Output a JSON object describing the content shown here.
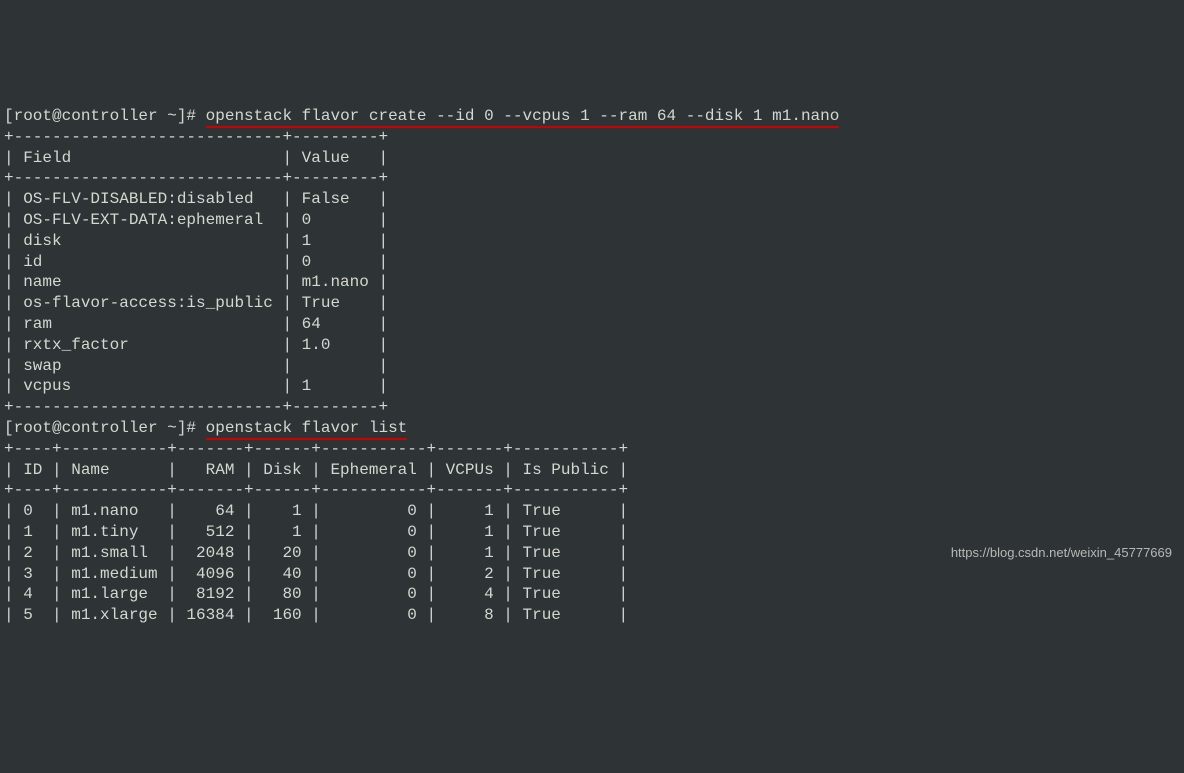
{
  "prompt1_prefix": "[root@controller ~]# ",
  "command1": "openstack flavor create --id 0 --vcpus 1 --ram 64 --disk 1 m1.nano",
  "divider1": "+----------------------------+---------+",
  "header1": "| Field                      | Value   |",
  "rows1": [
    "| OS-FLV-DISABLED:disabled   | False   |",
    "| OS-FLV-EXT-DATA:ephemeral  | 0       |",
    "| disk                       | 1       |",
    "| id                         | 0       |",
    "| name                       | m1.nano |",
    "| os-flavor-access:is_public | True    |",
    "| ram                        | 64      |",
    "| rxtx_factor                | 1.0     |",
    "| swap                       |         |",
    "| vcpus                      | 1       |"
  ],
  "prompt2_prefix": "[root@controller ~]# ",
  "command2": "openstack flavor list",
  "divider2": "+----+-----------+-------+------+-----------+-------+-----------+",
  "header2": "| ID | Name      |   RAM | Disk | Ephemeral | VCPUs | Is Public |",
  "rows2": [
    "| 0  | m1.nano   |    64 |    1 |         0 |     1 | True      |",
    "| 1  | m1.tiny   |   512 |    1 |         0 |     1 | True      |",
    "| 2  | m1.small  |  2048 |   20 |         0 |     1 | True      |",
    "| 3  | m1.medium |  4096 |   40 |         0 |     2 | True      |",
    "| 4  | m1.large  |  8192 |   80 |         0 |     4 | True      |",
    "| 5  | m1.xlarge | 16384 |  160 |         0 |     8 | True      |"
  ],
  "create_table": {
    "fields": [
      {
        "field": "OS-FLV-DISABLED:disabled",
        "value": "False"
      },
      {
        "field": "OS-FLV-EXT-DATA:ephemeral",
        "value": "0"
      },
      {
        "field": "disk",
        "value": "1"
      },
      {
        "field": "id",
        "value": "0"
      },
      {
        "field": "name",
        "value": "m1.nano"
      },
      {
        "field": "os-flavor-access:is_public",
        "value": "True"
      },
      {
        "field": "ram",
        "value": "64"
      },
      {
        "field": "rxtx_factor",
        "value": "1.0"
      },
      {
        "field": "swap",
        "value": ""
      },
      {
        "field": "vcpus",
        "value": "1"
      }
    ]
  },
  "list_table": {
    "headers": [
      "ID",
      "Name",
      "RAM",
      "Disk",
      "Ephemeral",
      "VCPUs",
      "Is Public"
    ],
    "data": [
      {
        "ID": "0",
        "Name": "m1.nano",
        "RAM": 64,
        "Disk": 1,
        "Ephemeral": 0,
        "VCPUs": 1,
        "Is Public": "True"
      },
      {
        "ID": "1",
        "Name": "m1.tiny",
        "RAM": 512,
        "Disk": 1,
        "Ephemeral": 0,
        "VCPUs": 1,
        "Is Public": "True"
      },
      {
        "ID": "2",
        "Name": "m1.small",
        "RAM": 2048,
        "Disk": 20,
        "Ephemeral": 0,
        "VCPUs": 1,
        "Is Public": "True"
      },
      {
        "ID": "3",
        "Name": "m1.medium",
        "RAM": 4096,
        "Disk": 40,
        "Ephemeral": 0,
        "VCPUs": 2,
        "Is Public": "True"
      },
      {
        "ID": "4",
        "Name": "m1.large",
        "RAM": 8192,
        "Disk": 80,
        "Ephemeral": 0,
        "VCPUs": 4,
        "Is Public": "True"
      },
      {
        "ID": "5",
        "Name": "m1.xlarge",
        "RAM": 16384,
        "Disk": 160,
        "Ephemeral": 0,
        "VCPUs": 8,
        "Is Public": "True"
      }
    ]
  },
  "watermark": "https://blog.csdn.net/weixin_45777669"
}
